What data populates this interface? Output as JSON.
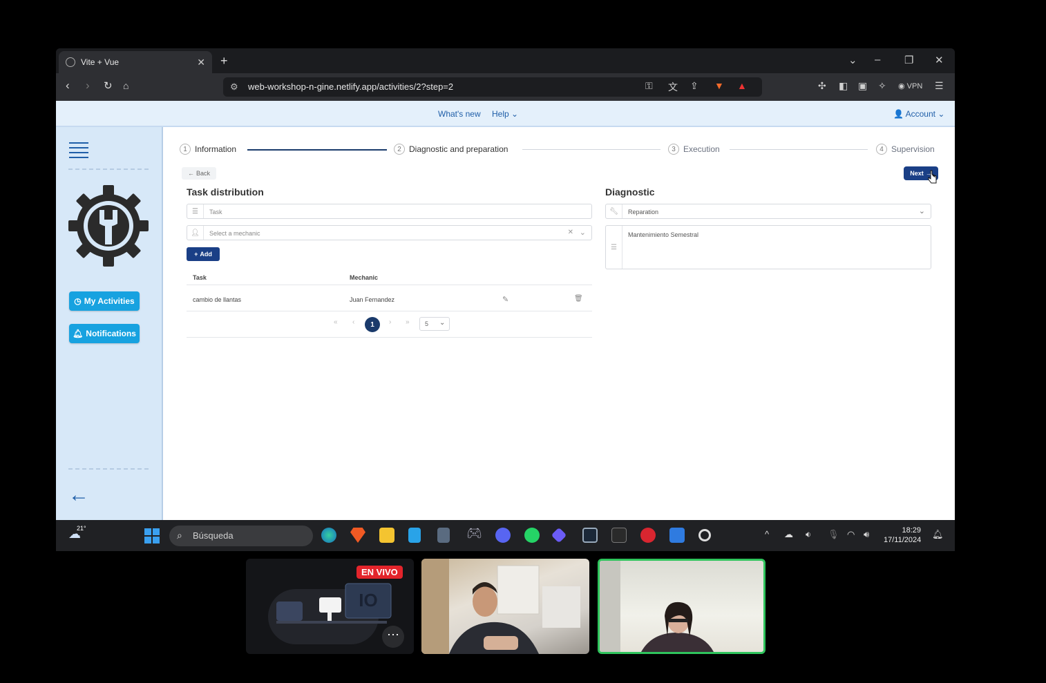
{
  "browser": {
    "tab_title": "Vite + Vue",
    "url": "web-workshop-n-gine.netlify.app/activities/2?step=2",
    "vpn_label": "VPN"
  },
  "topnav": {
    "whats_new": "What's new",
    "help": "Help",
    "account": "Account"
  },
  "sidebar": {
    "my_activities": "My Activities",
    "notifications": "Notifications"
  },
  "stepper": {
    "steps": [
      {
        "num": "1",
        "label": "Information"
      },
      {
        "num": "2",
        "label": "Diagnostic and preparation"
      },
      {
        "num": "3",
        "label": "Execution"
      },
      {
        "num": "4",
        "label": "Supervision"
      }
    ],
    "back": "Back",
    "next": "Next"
  },
  "task_distribution": {
    "title": "Task distribution",
    "task_placeholder": "Task",
    "mechanic_placeholder": "Select a mechanic",
    "add": "Add",
    "columns": [
      "Task",
      "Mechanic"
    ],
    "rows": [
      {
        "task": "cambio de llantas",
        "mechanic": "Juan Fernandez"
      }
    ],
    "pagination": {
      "current": "1",
      "page_size": "5"
    }
  },
  "diagnostic": {
    "title": "Diagnostic",
    "type": "Reparation",
    "description": "Mantenimiento Semestral"
  },
  "taskbar": {
    "weather": "21°",
    "search": "Búsqueda",
    "time": "18:29",
    "date": "17/11/2024"
  },
  "call": {
    "live_badge": "EN VIVO"
  },
  "colors": {
    "primary": "#1a3f86",
    "sidebar_button": "#17a2e0",
    "sidebar_bg": "#d7e8f8"
  }
}
